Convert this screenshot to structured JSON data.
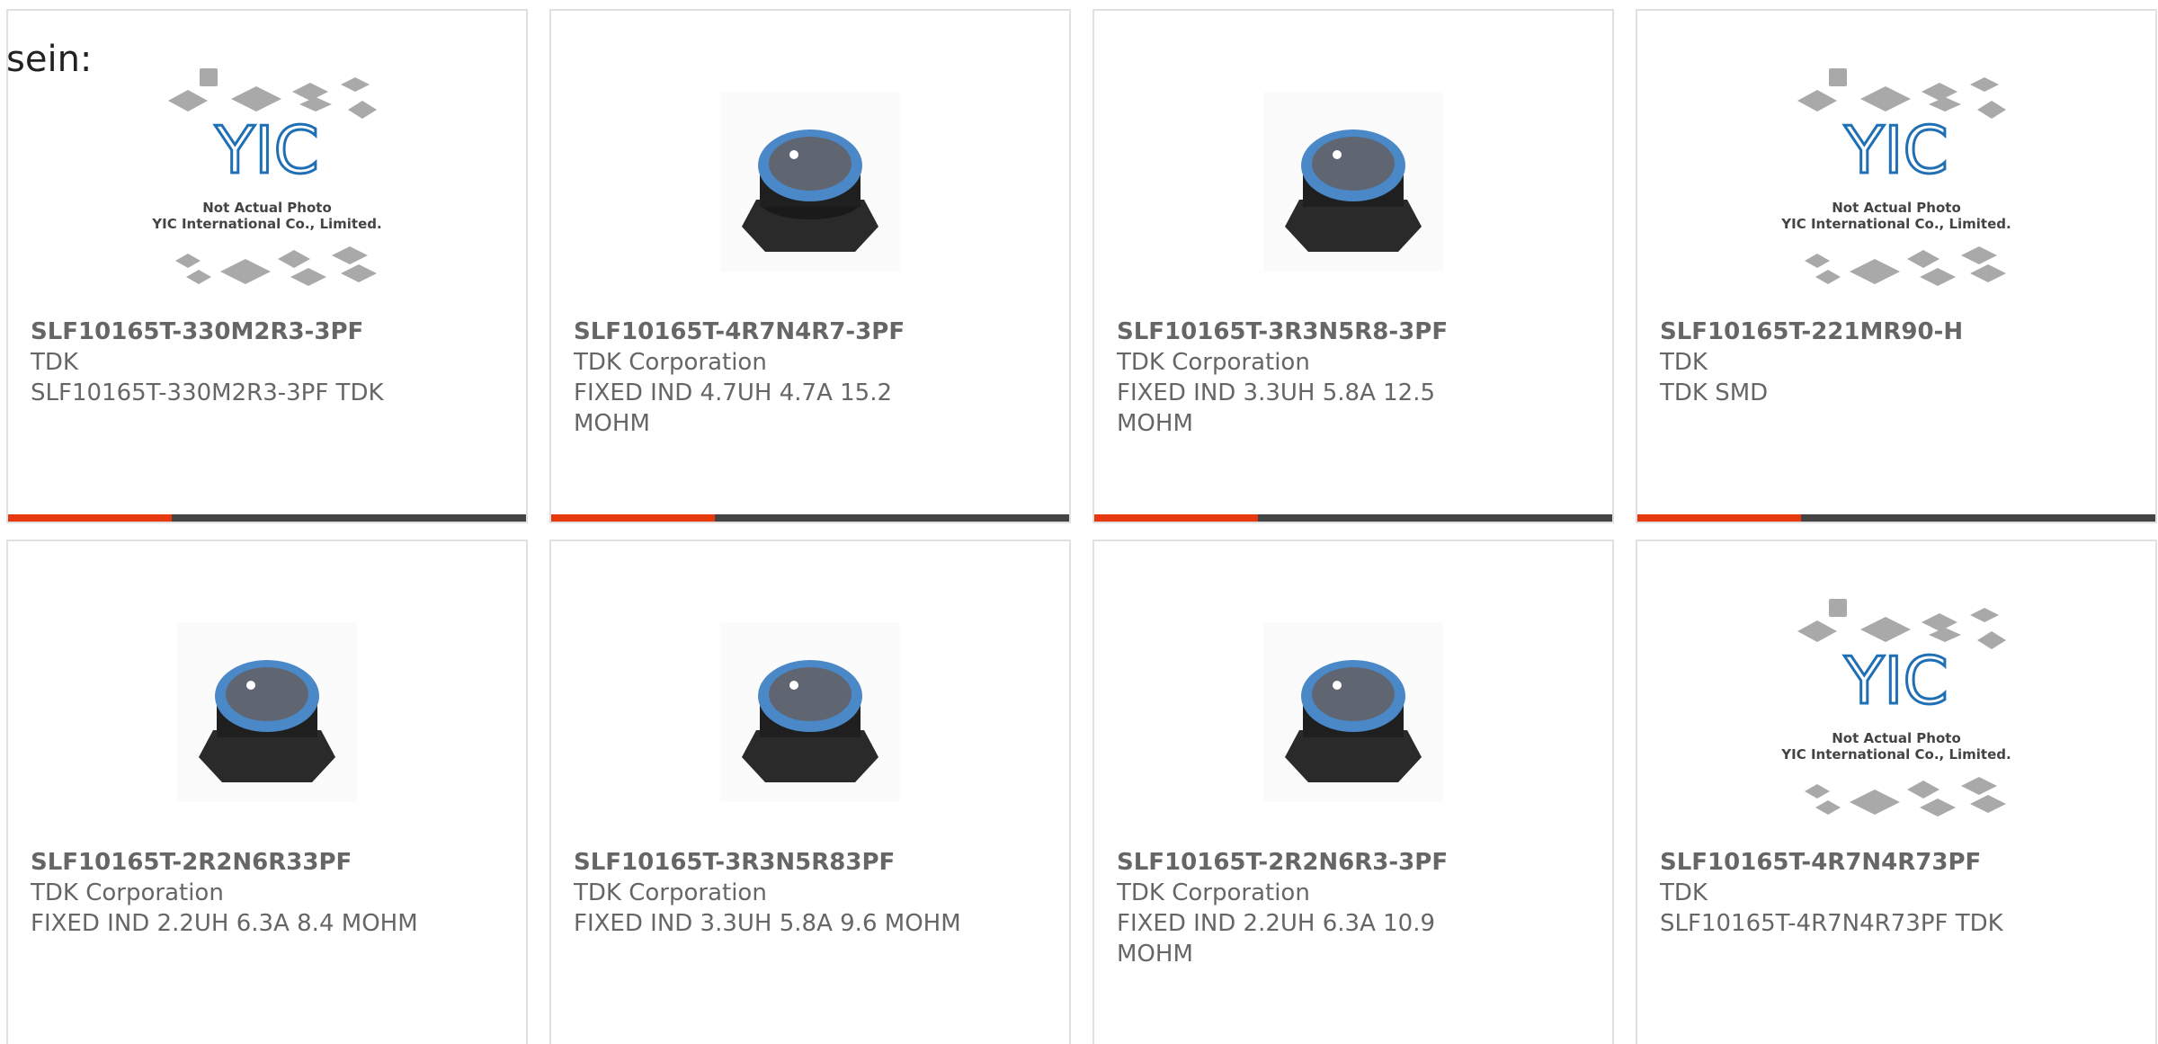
{
  "page_label": "sein:",
  "placeholder_image": {
    "line1": "Not Actual Photo",
    "line2": "YIC International Co., Limited.",
    "logo": "YIC"
  },
  "products": [
    {
      "part": "SLF10165T-330M2R3-3PF",
      "maker": "TDK",
      "desc": "SLF10165T-330M2R3-3PF TDK",
      "image": "placeholder",
      "accent_bar": true
    },
    {
      "part": "SLF10165T-4R7N4R7-3PF",
      "maker": "TDK Corporation",
      "desc": "FIXED IND 4.7UH 4.7A 15.2 MOHM",
      "image": "inductor",
      "accent_bar": true
    },
    {
      "part": "SLF10165T-3R3N5R8-3PF",
      "maker": "TDK Corporation",
      "desc": "FIXED IND 3.3UH 5.8A 12.5 MOHM",
      "image": "inductor",
      "accent_bar": true
    },
    {
      "part": "SLF10165T-221MR90-H",
      "maker": "TDK",
      "desc": "TDK SMD",
      "image": "placeholder",
      "accent_bar": true
    },
    {
      "part": "SLF10165T-2R2N6R33PF",
      "maker": "TDK Corporation",
      "desc": "FIXED IND 2.2UH 6.3A 8.4 MOHM",
      "image": "inductor",
      "accent_bar": false
    },
    {
      "part": "SLF10165T-3R3N5R83PF",
      "maker": "TDK Corporation",
      "desc": "FIXED IND 3.3UH 5.8A 9.6 MOHM",
      "image": "inductor",
      "accent_bar": false
    },
    {
      "part": "SLF10165T-2R2N6R3-3PF",
      "maker": "TDK Corporation",
      "desc": "FIXED IND 2.2UH 6.3A 10.9 MOHM",
      "image": "inductor",
      "accent_bar": false
    },
    {
      "part": "SLF10165T-4R7N4R73PF",
      "maker": "TDK",
      "desc": "SLF10165T-4R7N4R73PF TDK",
      "image": "placeholder",
      "accent_bar": false
    }
  ],
  "colors": {
    "accent": "#e8390e",
    "bar_dark": "#444444",
    "text": "#666666",
    "border": "#e0e0e0",
    "logo_blue": "#1f6fb5"
  }
}
